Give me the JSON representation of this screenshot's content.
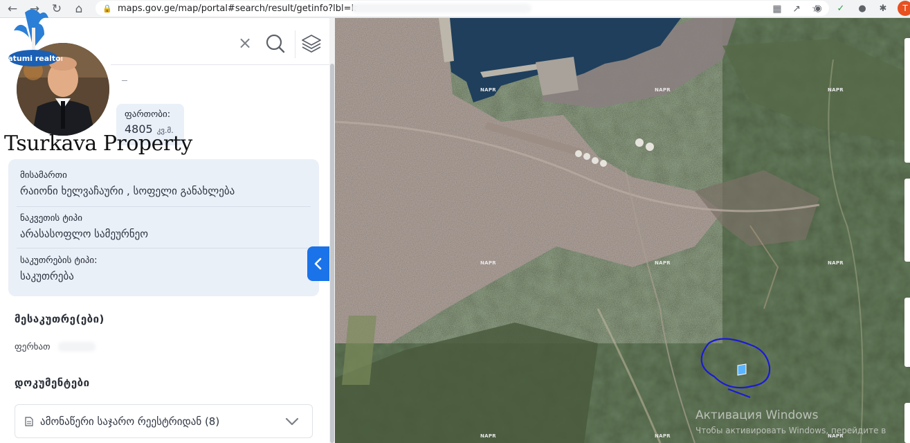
{
  "browser": {
    "url": "maps.gov.ge/map/portal#search/result/getinfo?lbl=Ir",
    "profile_initial": "T",
    "icons": [
      "back-icon",
      "forward-icon",
      "reload-icon",
      "home-icon",
      "lock-icon",
      "translate-icon",
      "share-icon",
      "star-icon",
      "extensions-icon"
    ]
  },
  "overlay": {
    "logo_text": "Batumi realtor",
    "brand_name": "Tsurkava Property"
  },
  "area": {
    "label": "ფართობი:",
    "value": "4805",
    "unit": "კვ.მ."
  },
  "info": {
    "address_label": "მისამართი",
    "address_value": "რაიონი ხელვაჩაური , სოფელი განახლება",
    "land_type_label": "ნაკვეთის ტიპი",
    "land_type_value": "არასასოფლო სამეურნეო",
    "ownership_type_label": "საკუთრების ტიპი:",
    "ownership_type_value": "საკუთრება"
  },
  "owners": {
    "heading": "მესაკუთრე(ები)",
    "name": "ფერხათ"
  },
  "documents": {
    "heading": "დოკუმენტები",
    "item_label": "ამონაწერი საჯარო რეესტრიდან (8)"
  },
  "map": {
    "watermark_labels": [
      "NAPR",
      "NAPR",
      "NAPR",
      "NAPR",
      "NAPR",
      "NAPR",
      "NAPR",
      "NAPR",
      "NAPR",
      "NAPR",
      "NAPR",
      "NAPR",
      "NAPR"
    ],
    "windows_activation_title": "Активация Windows",
    "windows_activation_sub": "Чтобы активировать Windows, перейдите в"
  },
  "colors": {
    "accent": "#1a73e8",
    "card_bg": "#eaf0f8",
    "sea": "#1f3f5c",
    "outline": "#1a1ad8"
  }
}
